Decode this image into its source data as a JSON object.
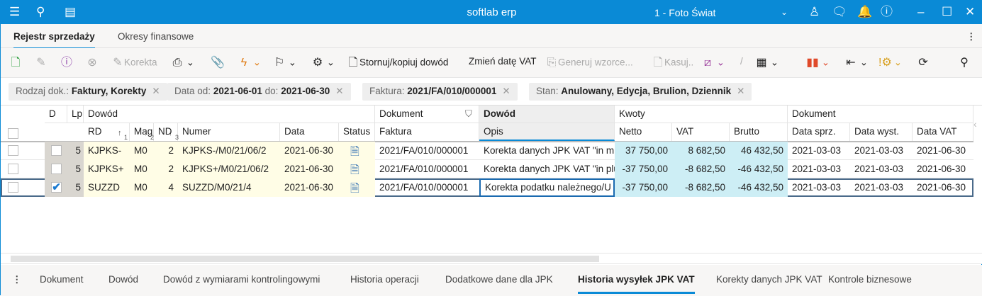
{
  "titlebar": {
    "app": "softlab erp",
    "company": "1 - Foto Świat"
  },
  "tabs": [
    {
      "label": "Rejestr sprzedaży",
      "active": true
    },
    {
      "label": "Okresy finansowe",
      "active": false
    }
  ],
  "toolbar": {
    "korekta": "Korekta",
    "stornuj": "Stornuj/kopiuj dowód",
    "zmien": "Zmień datę VAT",
    "generuj": "Generuj wzorce...",
    "kasuj": "Kasuj.."
  },
  "filters": [
    {
      "label": "Rodzaj dok.:",
      "value": "Faktury, Korekty"
    },
    {
      "label": "Data  od:",
      "value": "2021-06-01",
      "label2": "do:",
      "value2": "2021-06-30"
    },
    {
      "label": "Faktura:",
      "value": "2021/FA/010/000001"
    },
    {
      "label": "Stan:",
      "value": "Anulowany, Edycja, Brulion, Dziennik"
    }
  ],
  "grid": {
    "groups": {
      "d": "D",
      "lp": "Lp",
      "dowod": "Dowód",
      "dokument": "Dokument",
      "dowod2": "Dowód",
      "kwoty": "Kwoty",
      "dokument2": "Dokument"
    },
    "headers": [
      "RD",
      "Mag",
      "ND",
      "Numer",
      "Data",
      "Status",
      "Faktura",
      "Opis",
      "Netto",
      "VAT",
      "Brutto",
      "Data sprz.",
      "Data wyst.",
      "Data VAT"
    ],
    "sort": {
      "rd": "1",
      "mag": "2",
      "nd": "3"
    },
    "rows": [
      {
        "checked": false,
        "d": false,
        "lp": "5",
        "rd": "KJPKS-",
        "mag": "M0",
        "nd": "2",
        "numer": "KJPKS-/M0/21/06/2",
        "data": "2021-06-30",
        "faktura": "2021/FA/010/000001",
        "opis": "Korekta danych JPK VAT \"in minus\"",
        "netto": "37 750,00",
        "vat": "8 682,50",
        "brutto": "46 432,50",
        "sprz": "2021-03-03",
        "wyst": "2021-03-03",
        "datavat": "2021-06-30"
      },
      {
        "checked": false,
        "d": false,
        "lp": "5",
        "rd": "KJPKS+",
        "mag": "M0",
        "nd": "2",
        "numer": "KJPKS+/M0/21/06/2",
        "data": "2021-06-30",
        "faktura": "2021/FA/010/000001",
        "opis": "Korekta danych JPK VAT \"in plus\"",
        "netto": "-37 750,00",
        "vat": "-8 682,50",
        "brutto": "-46 432,50",
        "sprz": "2021-03-03",
        "wyst": "2021-03-03",
        "datavat": "2021-06-30"
      },
      {
        "checked": false,
        "d": true,
        "lp": "5",
        "rd": "SUZZD",
        "mag": "M0",
        "nd": "4",
        "numer": "SUZZD/M0/21/4",
        "data": "2021-06-30",
        "faktura": "2021/FA/010/000001",
        "opis": "Korekta podatku należnego/U",
        "netto": "-37 750,00",
        "vat": "-8 682,50",
        "brutto": "-46 432,50",
        "sprz": "2021-03-03",
        "wyst": "2021-03-03",
        "datavat": "2021-06-30"
      }
    ]
  },
  "bottom_tabs": [
    {
      "label": "Dokument"
    },
    {
      "label": "Dowód"
    },
    {
      "label": "Dowód z wymiarami kontrolingowymi"
    },
    {
      "label": "Historia operacji"
    },
    {
      "label": "Dodatkowe dane dla JPK"
    },
    {
      "label": "Historia wysyłek JPK VAT",
      "active": true
    },
    {
      "label": "Korekty danych JPK VAT"
    },
    {
      "label": "Kontrole biznesowe"
    }
  ],
  "colors": {
    "accent": "#0a8ad6",
    "yellow": "#fffde6",
    "blue": "#cdeef5"
  }
}
